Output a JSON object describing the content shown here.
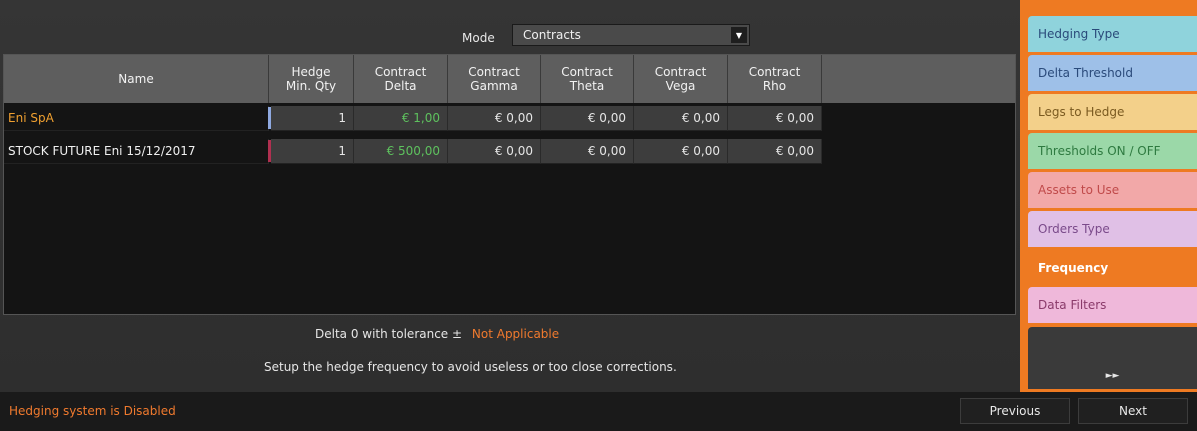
{
  "mode": {
    "label": "Mode",
    "value": "Contracts"
  },
  "table": {
    "headers": [
      "Name",
      "Hedge\nMin. Qty",
      "Contract\nDelta",
      "Contract\nGamma",
      "Contract\nTheta",
      "Contract\nVega",
      "Contract\nRho"
    ],
    "rows": [
      {
        "name": "Eni SpA",
        "qty": "1",
        "delta": "€ 1,00",
        "gamma": "€ 0,00",
        "theta": "€ 0,00",
        "vega": "€ 0,00",
        "rho": "€ 0,00",
        "marker_color": "#8fa9e0",
        "name_color": "#f0a030"
      },
      {
        "name": "STOCK FUTURE Eni 15/12/2017",
        "qty": "1",
        "delta": "€ 500,00",
        "gamma": "€ 0,00",
        "theta": "€ 0,00",
        "vega": "€ 0,00",
        "rho": "€ 0,00",
        "marker_color": "#b03050",
        "name_color": "#f0f0f0"
      }
    ]
  },
  "tolerance": {
    "label": "Delta 0 with tolerance ±",
    "value": "Not Applicable"
  },
  "hint": "Setup the hedge frequency to avoid useless or too close corrections.",
  "status": "Hedging system is Disabled",
  "nav": {
    "previous": "Previous",
    "next": "Next"
  },
  "tabs": [
    {
      "label": "Hedging Type",
      "bg": "#8fd3dc",
      "color": "#2a4a7a"
    },
    {
      "label": "Delta Threshold",
      "bg": "#9ec0e8",
      "color": "#2a4a7a"
    },
    {
      "label": "Legs to Hedge",
      "bg": "#f3d08a",
      "color": "#7a5a20"
    },
    {
      "label": "Thresholds ON / OFF",
      "bg": "#9bd8a8",
      "color": "#2e7a40"
    },
    {
      "label": "Assets to Use",
      "bg": "#f2a8a8",
      "color": "#c04a4a"
    },
    {
      "label": "Orders Type",
      "bg": "#e0c0e6",
      "color": "#7a4a8a"
    },
    {
      "label": "Frequency",
      "bg": "#ee7a22",
      "color": "#ffffff"
    },
    {
      "label": "Data Filters",
      "bg": "#efb8da",
      "color": "#8a3a6a"
    }
  ],
  "more_icon": "double-chevron-right-icon",
  "colors": {
    "accent": "#ee7a22",
    "positive": "#5ec15e",
    "warning": "#f07a2e"
  }
}
